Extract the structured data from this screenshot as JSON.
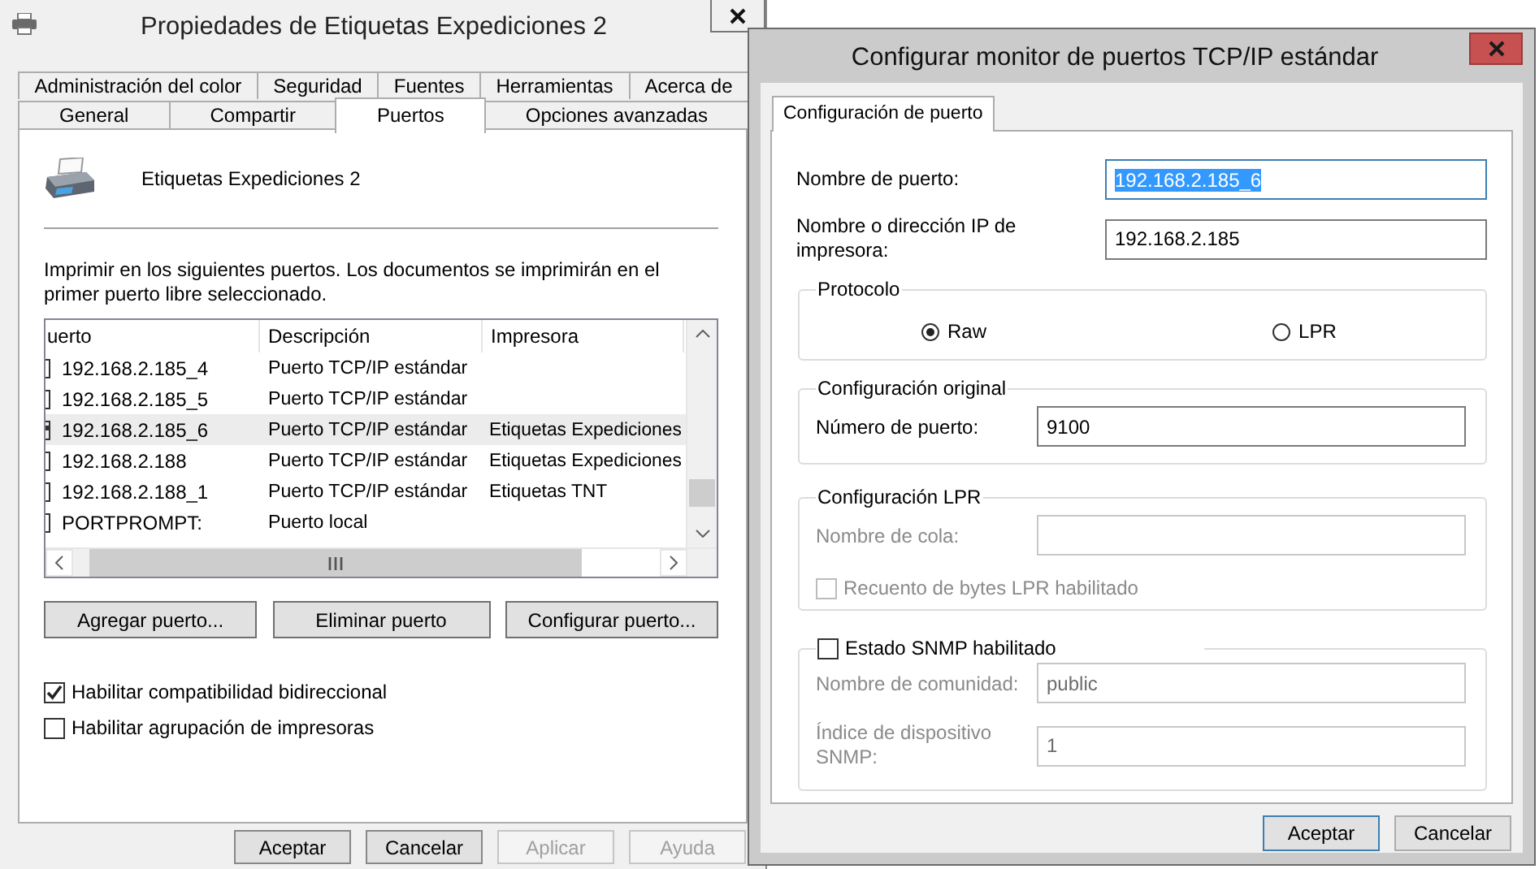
{
  "back_window": {
    "title": "Propiedades de Etiquetas Expediciones 2",
    "tab_rows": [
      [
        {
          "label": "Administración del color",
          "selected": false
        },
        {
          "label": "Seguridad",
          "selected": false
        },
        {
          "label": "Fuentes",
          "selected": false
        },
        {
          "label": "Herramientas",
          "selected": false
        },
        {
          "label": "Acerca de",
          "selected": false
        }
      ],
      [
        {
          "label": "General",
          "selected": false
        },
        {
          "label": "Compartir",
          "selected": false
        },
        {
          "label": "Puertos",
          "selected": true
        },
        {
          "label": "Opciones avanzadas",
          "selected": false
        }
      ]
    ],
    "printer_name": "Etiquetas Expediciones 2",
    "description": "Imprimir en los siguientes puertos. Los documentos se imprimirán en el primer puerto libre seleccionado.",
    "ports": {
      "columns": [
        "uerto",
        "Descripción",
        "Impresora"
      ],
      "rows": [
        {
          "port": "192.168.2.185_4",
          "description": "Puerto TCP/IP estándar",
          "printer": "",
          "checked": false,
          "selected": false
        },
        {
          "port": "192.168.2.185_5",
          "description": "Puerto TCP/IP estándar",
          "printer": "",
          "checked": false,
          "selected": false
        },
        {
          "port": "192.168.2.185_6",
          "description": "Puerto TCP/IP estándar",
          "printer": "Etiquetas Expediciones",
          "checked": true,
          "selected": true
        },
        {
          "port": "192.168.2.188",
          "description": "Puerto TCP/IP estándar",
          "printer": "Etiquetas Expediciones",
          "checked": false,
          "selected": false
        },
        {
          "port": "192.168.2.188_1",
          "description": "Puerto TCP/IP estándar",
          "printer": "Etiquetas TNT",
          "checked": false,
          "selected": false
        },
        {
          "port": "PORTPROMPT:",
          "description": "Puerto local",
          "printer": "",
          "checked": false,
          "selected": false
        }
      ]
    },
    "port_buttons": [
      "Agregar puerto...",
      "Eliminar puerto",
      "Configurar puerto..."
    ],
    "options": [
      {
        "label": "Habilitar compatibilidad bidireccional",
        "checked": true
      },
      {
        "label": "Habilitar agrupación de impresoras",
        "checked": false
      }
    ],
    "footer_buttons": [
      {
        "label": "Aceptar",
        "disabled": false
      },
      {
        "label": "Cancelar",
        "disabled": false
      },
      {
        "label": "Aplicar",
        "disabled": true
      },
      {
        "label": "Ayuda",
        "disabled": true
      }
    ]
  },
  "front_window": {
    "title": "Configurar monitor de puertos TCP/IP estándar",
    "tab": {
      "label": "Configuración de puerto",
      "selected": true
    },
    "port_name": {
      "label": "Nombre de puerto:",
      "value": "192.168.2.185_6",
      "text_selected": true
    },
    "printer_address": {
      "label": "Nombre o dirección IP de impresora:",
      "value": "192.168.2.185"
    },
    "protocol": {
      "legend": "Protocolo",
      "options": [
        {
          "label": "Raw",
          "selected": true
        },
        {
          "label": "LPR",
          "selected": false
        }
      ]
    },
    "original": {
      "legend": "Configuración original",
      "label": "Número de puerto:",
      "value": "9100"
    },
    "lpr": {
      "legend": "Configuración LPR",
      "disabled": true,
      "queue_label": "Nombre de cola:",
      "byte_count": {
        "label": "Recuento de bytes LPR habilitado",
        "checked": false
      }
    },
    "snmp": {
      "label": "Estado SNMP habilitado",
      "checked": false,
      "disabled": true,
      "community_label": "Nombre de comunidad:",
      "community": "public",
      "index_label": "Índice de dispositivo SNMP:",
      "index": "1"
    },
    "buttons": [
      {
        "label": "Aceptar",
        "default": true
      },
      {
        "label": "Cancelar",
        "default": false
      }
    ]
  }
}
